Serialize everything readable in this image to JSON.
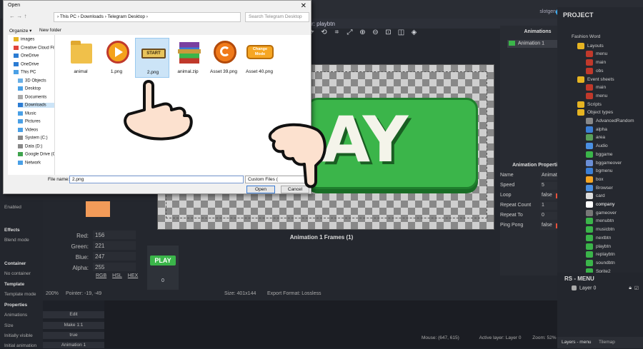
{
  "editor": {
    "tab_title": "r: playbtn",
    "user_name": "slotgen",
    "frames_title": "Animation 1 Frames (1)",
    "frame_label": "PLAY",
    "frame_number": "0",
    "play_text": "AY",
    "status": {
      "zoom": "200%",
      "pointer": "Pointer: -19, -49",
      "size": "Size: 401x144",
      "export": "Export Format: Lossless"
    },
    "bottom_status": {
      "mouse": "Mouse: (647, 615)",
      "active_layer": "Active layer: Layer 0",
      "zoom": "Zoom: 52%"
    }
  },
  "color": {
    "red_label": "Red:",
    "red": "156",
    "green_label": "Green:",
    "green": "221",
    "blue_label": "Blue:",
    "blue": "247",
    "alpha_label": "Alpha:",
    "alpha": "255",
    "modes": [
      "RGB",
      "HSL",
      "HEX"
    ],
    "swatch": "#f29b59"
  },
  "left_props": {
    "enabled": "Enabled",
    "effects": "Effects",
    "blend_mode": "Blend mode",
    "container": "Container",
    "no_container": "No container",
    "template": "Template",
    "template_mode": "Template mode",
    "properties": "Properties",
    "animations": "Animations",
    "animations_value": "Edit",
    "size": "Size",
    "size_value": "Make 1:1",
    "initially_visible": "Initially visible",
    "initially_visible_value": "true",
    "initial_animation": "Initial animation",
    "initial_animation_value": "Animation 1"
  },
  "animations": {
    "title": "Animations",
    "item": "Animation 1",
    "props_title": "Animation Properties",
    "rows": [
      {
        "k": "Name",
        "v": "Animation 1"
      },
      {
        "k": "Speed",
        "v": "5"
      },
      {
        "k": "Loop",
        "v": "false"
      },
      {
        "k": "Repeat Count",
        "v": "1"
      },
      {
        "k": "Repeat To",
        "v": "0"
      },
      {
        "k": "Ping Pong",
        "v": "false"
      }
    ]
  },
  "project": {
    "title": "PROJECT",
    "items": [
      {
        "label": "Fashion Word",
        "color": "#25282f"
      },
      {
        "label": "Layouts",
        "color": "#e6b422"
      },
      {
        "label": "menu",
        "color": "#c0392b"
      },
      {
        "label": "main",
        "color": "#c0392b"
      },
      {
        "label": "obs",
        "color": "#c0392b"
      },
      {
        "label": "Event sheets",
        "color": "#e6b422"
      },
      {
        "label": "main",
        "color": "#c0392b"
      },
      {
        "label": "menu",
        "color": "#c0392b"
      },
      {
        "label": "Scripts",
        "color": "#e6b422"
      },
      {
        "label": "Object types",
        "color": "#e6b422"
      },
      {
        "label": "AdvancedRandom",
        "color": "#888888"
      },
      {
        "label": "alpha",
        "color": "#3b7fd6"
      },
      {
        "label": "area",
        "color": "#5aa05a"
      },
      {
        "label": "Audio",
        "color": "#4a90e2"
      },
      {
        "label": "bggame",
        "color": "#3bb54a"
      },
      {
        "label": "bggameover",
        "color": "#6b8fd6"
      },
      {
        "label": "bgmenu",
        "color": "#3b7fd6"
      },
      {
        "label": "box",
        "color": "#f5a623"
      },
      {
        "label": "Browser",
        "color": "#4a90e2"
      },
      {
        "label": "card",
        "color": "#dddddd"
      },
      {
        "label": "company",
        "color": "#ffffff"
      },
      {
        "label": "gameover",
        "color": "#777777"
      },
      {
        "label": "menubtn",
        "color": "#3bb54a"
      },
      {
        "label": "musicbtn",
        "color": "#3bb54a"
      },
      {
        "label": "nextbtn",
        "color": "#3bb54a"
      },
      {
        "label": "playbtn",
        "color": "#3bb54a"
      },
      {
        "label": "replaybtn",
        "color": "#3bb54a"
      },
      {
        "label": "soundbtn",
        "color": "#3bb54a"
      },
      {
        "label": "Sprite2",
        "color": "#3bb54a"
      }
    ],
    "layers_title": "RS - MENU",
    "layer_name": "Layer 0",
    "tab_layers": "Layers - menu",
    "tab_tilemap": "Tilemap"
  },
  "dialog": {
    "title": "Open",
    "close": "✕",
    "address": "› This PC › Downloads › Telegram Desktop ›",
    "search_placeholder": "Search Telegram Desktop",
    "organize": "Organize ▾",
    "new_folder": "New folder",
    "tree": [
      {
        "label": "images",
        "color": "#e6b422"
      },
      {
        "label": "Creative Cloud Fil",
        "color": "#e0443a"
      },
      {
        "label": "OneDrive",
        "color": "#2b7cd3"
      },
      {
        "label": "OneDrive",
        "color": "#2b7cd3"
      },
      {
        "label": "This PC",
        "color": "#4aa0e6"
      },
      {
        "label": "3D Objects",
        "color": "#6ab0e6"
      },
      {
        "label": "Desktop",
        "color": "#4aa0e6"
      },
      {
        "label": "Documents",
        "color": "#aaaaaa"
      },
      {
        "label": "Downloads",
        "color": "#2b7cd3"
      },
      {
        "label": "Music",
        "color": "#4aa0e6"
      },
      {
        "label": "Pictures",
        "color": "#4aa0e6"
      },
      {
        "label": "Videos",
        "color": "#4aa0e6"
      },
      {
        "label": "System (C:)",
        "color": "#888888"
      },
      {
        "label": "Data (D:)",
        "color": "#888888"
      },
      {
        "label": "Google Drive (G",
        "color": "#3fa34d"
      },
      {
        "label": "Network",
        "color": "#4aa0e6"
      }
    ],
    "files": [
      {
        "label": "animal",
        "kind": "folder"
      },
      {
        "label": "1.png",
        "kind": "play"
      },
      {
        "label": "2.png",
        "kind": "start",
        "art": "START"
      },
      {
        "label": "animal.zip",
        "kind": "zip"
      },
      {
        "label": "Asset 39.png",
        "kind": "replay"
      },
      {
        "label": "Asset 40.png",
        "kind": "change",
        "art": "Change Mode"
      }
    ],
    "filename_label": "File name:",
    "filename_value": "2.png",
    "filter_value": "Custom Files (",
    "open_label": "Open",
    "cancel_label": "Cancel"
  }
}
